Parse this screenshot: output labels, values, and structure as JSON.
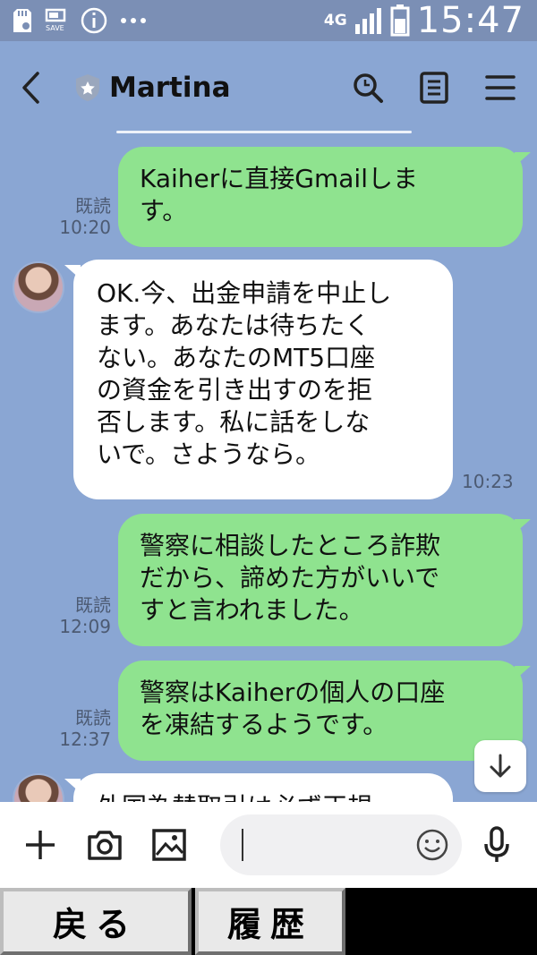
{
  "status_bar": {
    "save_label": "SAVE",
    "network": "4G",
    "time": "15:47"
  },
  "header": {
    "title": "Martina",
    "icons": [
      "back-icon",
      "shield-icon",
      "search-icon",
      "notes-icon",
      "menu-icon"
    ]
  },
  "messages": [
    {
      "dir": "out",
      "text": "Kaiherに直接Gmailしま\nす。",
      "read": "既読",
      "time": "10:20"
    },
    {
      "dir": "in",
      "text": "OK.今、出金申請を中止し\nます。あなたは待ちたく\nない。あなたのMT5口座\nの資金を引き出すのを拒\n否します。私に話をしな\nいで。さようなら。",
      "time": "10:23"
    },
    {
      "dir": "out",
      "text": "警察に相談したところ詐欺\nだから、諦めた方がいいで\nすと言われました。",
      "read": "既読",
      "time": "12:09"
    },
    {
      "dir": "out",
      "text": "警察はKaiherの個人の口座\nを凍結するようです。",
      "read": "既読",
      "time": "12:37"
    },
    {
      "dir": "in",
      "text": "外国為替取引は必ず正規",
      "time": ""
    }
  ],
  "input_bar": {
    "placeholder": "",
    "icons": [
      "plus-icon",
      "camera-icon",
      "image-icon",
      "emoji-icon",
      "mic-icon"
    ]
  },
  "soft_keys": {
    "back_label": "戻る",
    "history_label": "履歴"
  },
  "colors": {
    "background": "#8aa6d3",
    "outgoing_bubble": "#8fe38f",
    "incoming_bubble": "#ffffff"
  }
}
